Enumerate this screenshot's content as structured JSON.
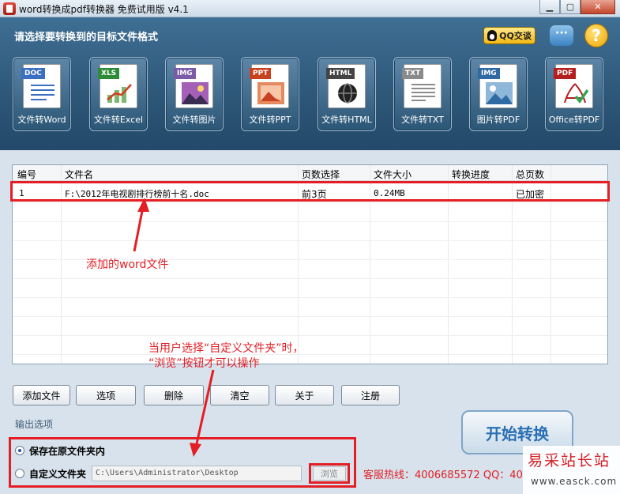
{
  "window": {
    "title": "word转换成pdf转换器 免费试用版 v4.1",
    "min_symbol": "▁",
    "max_symbol": "▢",
    "close_symbol": "✕"
  },
  "header": {
    "heading": "请选择要转换到的目标文件格式",
    "qq_button": "QQ交谈",
    "chat_symbol": "···",
    "help_symbol": "?"
  },
  "tools": [
    {
      "tag": "DOC",
      "label": "文件转Word",
      "tag_color": "#3b6fc1"
    },
    {
      "tag": "XLS",
      "label": "文件转Excel",
      "tag_color": "#2f8a3a"
    },
    {
      "tag": "IMG",
      "label": "文件转图片",
      "tag_color": "#7b5aa6"
    },
    {
      "tag": "PPT",
      "label": "文件转PPT",
      "tag_color": "#c9421f"
    },
    {
      "tag": "HTML",
      "label": "文件转HTML",
      "tag_color": "#444444"
    },
    {
      "tag": "TXT",
      "label": "文件转TXT",
      "tag_color": "#8a8a8a"
    },
    {
      "tag": "IMG",
      "label": "图片转PDF",
      "tag_color": "#2f6aa3"
    },
    {
      "tag": "PDF",
      "label": "Office转PDF",
      "tag_color": "#b51e1e"
    }
  ],
  "table": {
    "columns": [
      "编号",
      "文件名",
      "页数选择",
      "文件大小",
      "转换进度",
      "总页数"
    ],
    "rows": [
      {
        "id": "1",
        "filename": "F:\\2012年电视剧排行榜前十名.doc",
        "pages": "前3页",
        "size": "0.24MB",
        "progress": "",
        "total": "已加密"
      }
    ]
  },
  "annotations": {
    "added_file": "添加的word文件",
    "custom_folder_line1": "当用户选择“自定义文件夹”时，",
    "custom_folder_line2": "“浏览”按钮才可以操作"
  },
  "buttons": {
    "add": "添加文件",
    "options": "选项",
    "delete": "删除",
    "clear": "清空",
    "about": "关于",
    "register": "注册"
  },
  "output": {
    "section_label": "输出选项",
    "save_original": "保存在原文件夹内",
    "custom_folder": "自定义文件夹",
    "path": "C:\\Users\\Administrator\\Desktop",
    "browse": "浏览"
  },
  "start_button": "开始转换",
  "hotline": "客服热线：4006685572 QQ：40",
  "watermark": {
    "top": "易采站长站",
    "bottom": "www.easck.com"
  },
  "colors": {
    "accent_red": "#e31e24",
    "header_blue": "#2d5677",
    "start_text": "#2a6fb3"
  }
}
